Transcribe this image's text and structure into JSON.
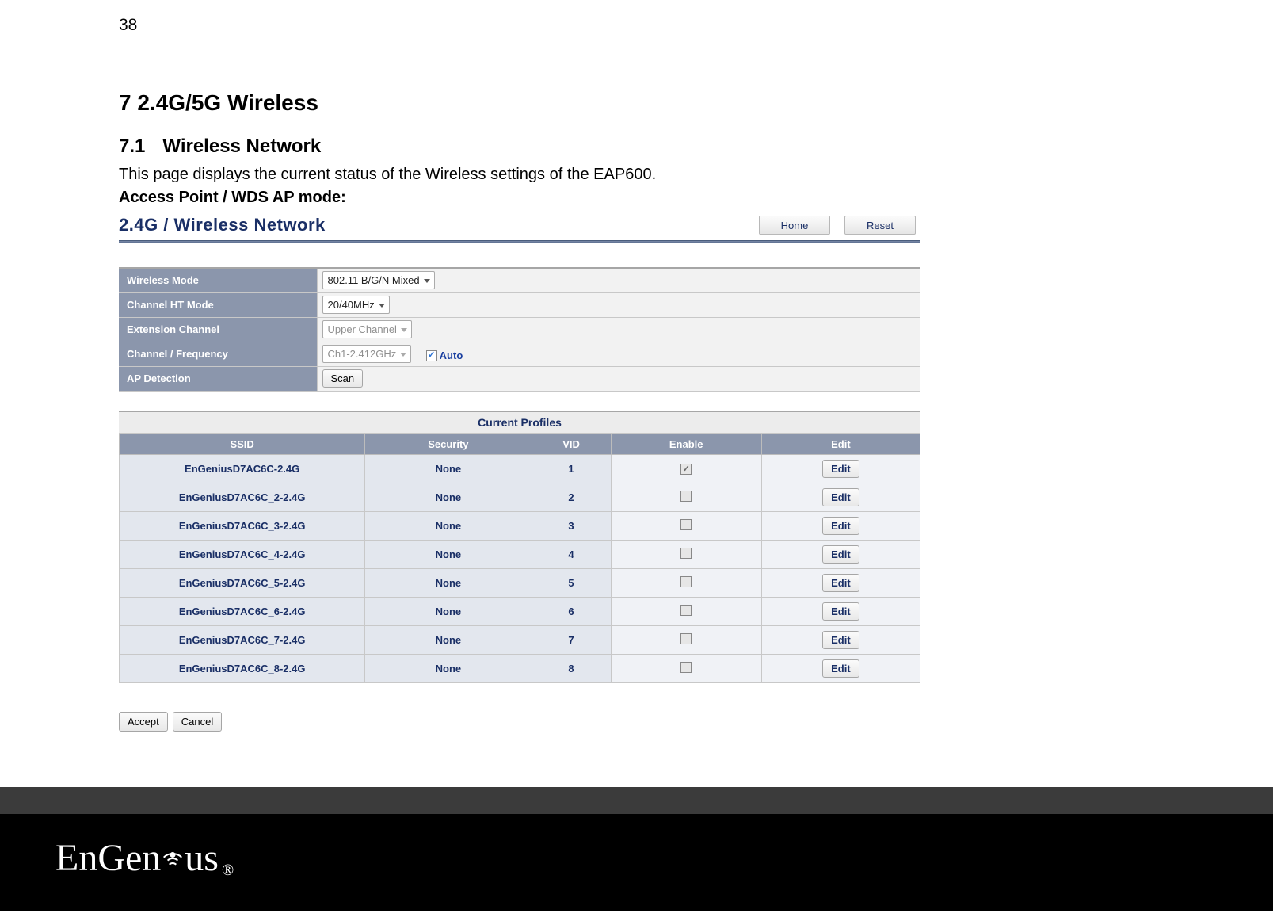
{
  "page_number": "38",
  "chapter_title": "7  2.4G/5G Wireless",
  "section_number": "7.1",
  "section_title": "Wireless Network",
  "intro_text": "This page displays the current status of the Wireless settings of the EAP600.",
  "mode_label": "Access Point / WDS AP mode:",
  "panel": {
    "title": "2.4G / Wireless Network",
    "home_btn": "Home",
    "reset_btn": "Reset",
    "rows": {
      "wireless_mode": {
        "label": "Wireless Mode",
        "value": "802.11 B/G/N Mixed"
      },
      "channel_ht": {
        "label": "Channel HT Mode",
        "value": "20/40MHz"
      },
      "ext_channel": {
        "label": "Extension Channel",
        "value": "Upper Channel"
      },
      "chan_freq": {
        "label": "Channel / Frequency",
        "value": "Ch1-2.412GHz",
        "auto_label": "Auto",
        "auto_checked": true
      },
      "ap_detect": {
        "label": "AP Detection",
        "scan_btn": "Scan"
      }
    },
    "profiles_caption": "Current Profiles",
    "profiles_headers": {
      "ssid": "SSID",
      "security": "Security",
      "vid": "VID",
      "enable": "Enable",
      "edit": "Edit"
    },
    "edit_btn": "Edit",
    "profiles": [
      {
        "ssid": "EnGeniusD7AC6C-2.4G",
        "security": "None",
        "vid": "1",
        "enabled": true
      },
      {
        "ssid": "EnGeniusD7AC6C_2-2.4G",
        "security": "None",
        "vid": "2",
        "enabled": false
      },
      {
        "ssid": "EnGeniusD7AC6C_3-2.4G",
        "security": "None",
        "vid": "3",
        "enabled": false
      },
      {
        "ssid": "EnGeniusD7AC6C_4-2.4G",
        "security": "None",
        "vid": "4",
        "enabled": false
      },
      {
        "ssid": "EnGeniusD7AC6C_5-2.4G",
        "security": "None",
        "vid": "5",
        "enabled": false
      },
      {
        "ssid": "EnGeniusD7AC6C_6-2.4G",
        "security": "None",
        "vid": "6",
        "enabled": false
      },
      {
        "ssid": "EnGeniusD7AC6C_7-2.4G",
        "security": "None",
        "vid": "7",
        "enabled": false
      },
      {
        "ssid": "EnGeniusD7AC6C_8-2.4G",
        "security": "None",
        "vid": "8",
        "enabled": false
      }
    ],
    "accept_btn": "Accept",
    "cancel_btn": "Cancel"
  },
  "logo_text": {
    "part1": "EnGen",
    "part2": "us",
    "reg": "®"
  }
}
